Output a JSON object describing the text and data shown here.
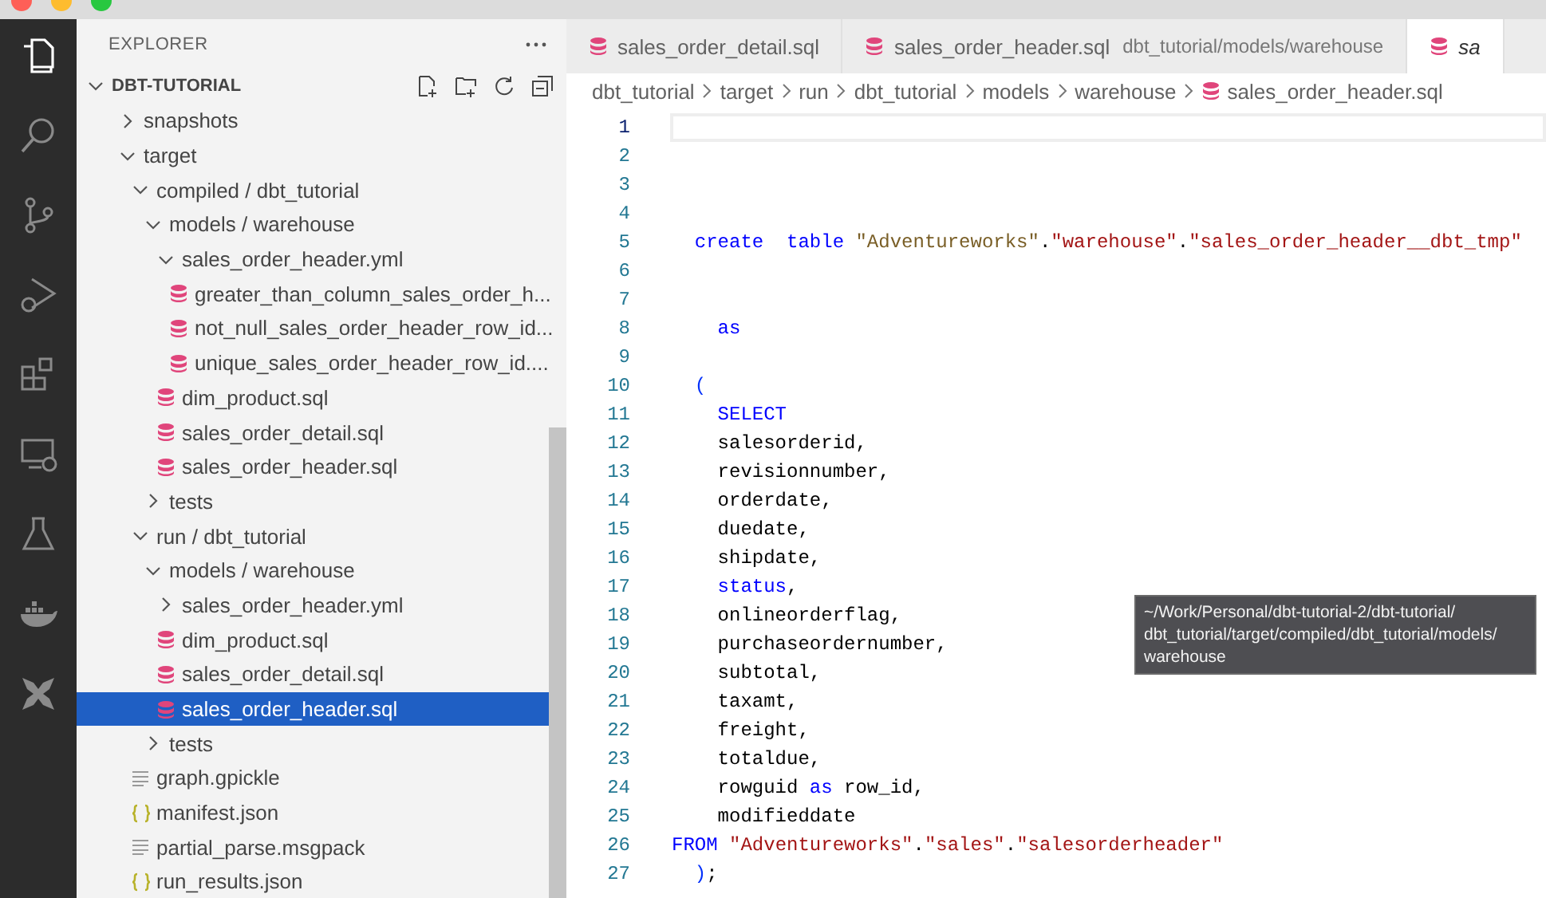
{
  "sidebar": {
    "title": "EXPLORER",
    "project": {
      "label": "DBT-TUTORIAL",
      "expanded": true
    },
    "tree": [
      {
        "label": "snapshots",
        "kind": "folder",
        "expanded": false,
        "selected": false
      },
      {
        "label": "target",
        "kind": "folder",
        "expanded": true,
        "selected": false,
        "children": [
          {
            "label": "compiled / dbt_tutorial",
            "kind": "folder",
            "expanded": true,
            "selected": false,
            "children": [
              {
                "label": "models / warehouse",
                "kind": "folder",
                "expanded": true,
                "selected": false,
                "children": [
                  {
                    "label": "sales_order_header.yml",
                    "kind": "folder",
                    "expanded": true,
                    "selected": false,
                    "children": [
                      {
                        "label": "greater_than_column_sales_order_h...",
                        "kind": "sql",
                        "selected": false
                      },
                      {
                        "label": "not_null_sales_order_header_row_id...",
                        "kind": "sql",
                        "selected": false
                      },
                      {
                        "label": "unique_sales_order_header_row_id....",
                        "kind": "sql",
                        "selected": false
                      }
                    ]
                  },
                  {
                    "label": "dim_product.sql",
                    "kind": "sql",
                    "selected": false
                  },
                  {
                    "label": "sales_order_detail.sql",
                    "kind": "sql",
                    "selected": false
                  },
                  {
                    "label": "sales_order_header.sql",
                    "kind": "sql",
                    "selected": false
                  }
                ]
              },
              {
                "label": "tests",
                "kind": "folder",
                "expanded": false,
                "selected": false
              }
            ]
          },
          {
            "label": "run / dbt_tutorial",
            "kind": "folder",
            "expanded": true,
            "selected": false,
            "children": [
              {
                "label": "models / warehouse",
                "kind": "folder",
                "expanded": true,
                "selected": false,
                "children": [
                  {
                    "label": "sales_order_header.yml",
                    "kind": "folder",
                    "expanded": false,
                    "selected": false
                  },
                  {
                    "label": "dim_product.sql",
                    "kind": "sql",
                    "selected": false
                  },
                  {
                    "label": "sales_order_detail.sql",
                    "kind": "sql",
                    "selected": false
                  },
                  {
                    "label": "sales_order_header.sql",
                    "kind": "sql",
                    "selected": true
                  }
                ]
              },
              {
                "label": "tests",
                "kind": "folder",
                "expanded": false,
                "selected": false
              }
            ]
          },
          {
            "label": "graph.gpickle",
            "kind": "text",
            "selected": false
          },
          {
            "label": "manifest.json",
            "kind": "json",
            "selected": false
          },
          {
            "label": "partial_parse.msgpack",
            "kind": "text",
            "selected": false
          },
          {
            "label": "run_results.json",
            "kind": "json",
            "selected": false
          }
        ]
      }
    ]
  },
  "tabs": [
    {
      "label": "sales_order_detail.sql",
      "selected": false
    },
    {
      "label": "sales_order_header.sql",
      "description": "dbt_tutorial/models/warehouse",
      "selected": false
    },
    {
      "label": "sa",
      "selected": true
    }
  ],
  "breadcrumbs": [
    "dbt_tutorial",
    "target",
    "run",
    "dbt_tutorial",
    "models",
    "warehouse",
    "sales_order_header.sql"
  ],
  "code": [
    {
      "number": "1",
      "current": true
    },
    {
      "number": "2",
      "current": false
    },
    {
      "number": "3",
      "current": false
    },
    {
      "number": "4",
      "current": false
    },
    {
      "number": "5",
      "current": false,
      "tokens": [
        {
          "kind": "keyword",
          "text": "  create"
        },
        {
          "kind": "keyword",
          "text": "  table"
        },
        {
          "kind": "schema",
          "text": " \"Adventureworks\""
        },
        {
          "kind": "plain",
          "text": "."
        },
        {
          "kind": "string",
          "text": "\"warehouse\""
        },
        {
          "kind": "plain",
          "text": "."
        },
        {
          "kind": "string",
          "text": "\"sales_order_header__dbt_tmp\""
        }
      ]
    },
    {
      "number": "6",
      "current": false
    },
    {
      "number": "7",
      "current": false
    },
    {
      "number": "8",
      "current": false,
      "tokens": [
        {
          "kind": "keyword",
          "text": "    as"
        }
      ]
    },
    {
      "number": "9",
      "current": false
    },
    {
      "number": "10",
      "current": false,
      "tokens": [
        {
          "kind": "bracket",
          "text": "  ("
        }
      ]
    },
    {
      "number": "11",
      "current": false,
      "tokens": [
        {
          "kind": "keyword",
          "text": "    SELECT"
        }
      ]
    },
    {
      "number": "12",
      "current": false,
      "tokens": [
        {
          "kind": "plain",
          "text": "    salesorderid,"
        }
      ]
    },
    {
      "number": "13",
      "current": false,
      "tokens": [
        {
          "kind": "plain",
          "text": "    revisionnumber,"
        }
      ]
    },
    {
      "number": "14",
      "current": false,
      "tokens": [
        {
          "kind": "plain",
          "text": "    orderdate,"
        }
      ]
    },
    {
      "number": "15",
      "current": false,
      "tokens": [
        {
          "kind": "plain",
          "text": "    duedate,"
        }
      ]
    },
    {
      "number": "16",
      "current": false,
      "tokens": [
        {
          "kind": "plain",
          "text": "    shipdate,"
        }
      ]
    },
    {
      "number": "17",
      "current": false,
      "tokens": [
        {
          "kind": "keyword",
          "text": "    status"
        },
        {
          "kind": "plain",
          "text": ","
        }
      ]
    },
    {
      "number": "18",
      "current": false,
      "tokens": [
        {
          "kind": "plain",
          "text": "    onlineorderflag,"
        }
      ]
    },
    {
      "number": "19",
      "current": false,
      "tokens": [
        {
          "kind": "plain",
          "text": "    purchaseordernumber,"
        }
      ]
    },
    {
      "number": "20",
      "current": false,
      "tokens": [
        {
          "kind": "plain",
          "text": "    subtotal,"
        }
      ]
    },
    {
      "number": "21",
      "current": false,
      "tokens": [
        {
          "kind": "plain",
          "text": "    taxamt,"
        }
      ]
    },
    {
      "number": "22",
      "current": false,
      "tokens": [
        {
          "kind": "plain",
          "text": "    freight,"
        }
      ]
    },
    {
      "number": "23",
      "current": false,
      "tokens": [
        {
          "kind": "plain",
          "text": "    totaldue,"
        }
      ]
    },
    {
      "number": "24",
      "current": false,
      "tokens": [
        {
          "kind": "plain",
          "text": "    rowguid "
        },
        {
          "kind": "keyword",
          "text": "as"
        },
        {
          "kind": "plain",
          "text": " row_id,"
        }
      ]
    },
    {
      "number": "25",
      "current": false,
      "tokens": [
        {
          "kind": "plain",
          "text": "    modifieddate"
        }
      ]
    },
    {
      "number": "26",
      "current": false,
      "tokens": [
        {
          "kind": "keyword",
          "text": "FROM"
        },
        {
          "kind": "string",
          "text": " \"Adventureworks\""
        },
        {
          "kind": "plain",
          "text": "."
        },
        {
          "kind": "string",
          "text": "\"sales\""
        },
        {
          "kind": "plain",
          "text": "."
        },
        {
          "kind": "string",
          "text": "\"salesorderheader\""
        }
      ]
    },
    {
      "number": "27",
      "current": false,
      "tokens": [
        {
          "kind": "bracket",
          "text": "  )"
        },
        {
          "kind": "plain",
          "text": ";"
        }
      ]
    }
  ],
  "tooltip": {
    "text": "~/Work/Personal/dbt-tutorial-2/dbt-tutorial/dbt_tutorial/target/compiled/dbt_tutorial/models/warehouse"
  }
}
